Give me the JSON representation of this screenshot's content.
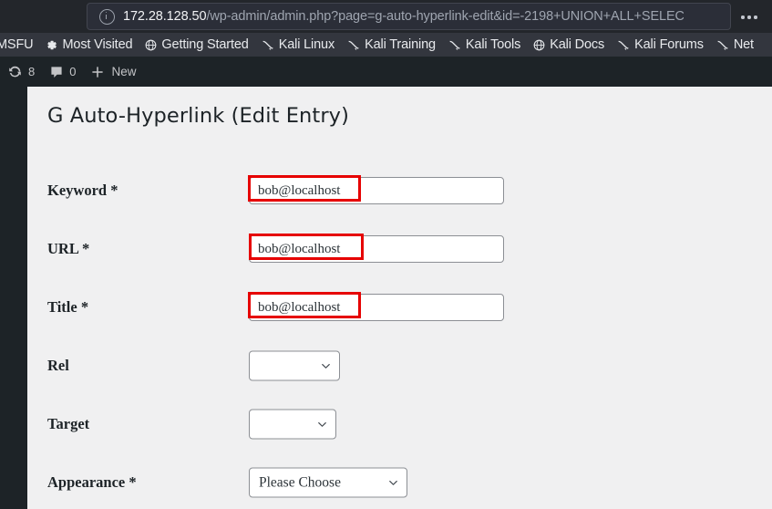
{
  "browser": {
    "url_host": "172.28.128.50",
    "url_path": "/wp-admin/admin.php?page=g-auto-hyperlink-edit&id=-2198+UNION+ALL+SELEC",
    "info_icon": "info-circle-icon",
    "menu_icon": "overflow-menu-icon",
    "bookmarks": [
      {
        "label": "MSFU",
        "icon": ""
      },
      {
        "label": "Most Visited",
        "icon": "gear-icon"
      },
      {
        "label": "Getting Started",
        "icon": "globe-icon"
      },
      {
        "label": "Kali Linux",
        "icon": "kali-dragon-icon"
      },
      {
        "label": "Kali Training",
        "icon": "kali-dragon-icon"
      },
      {
        "label": "Kali Tools",
        "icon": "kali-dragon-icon"
      },
      {
        "label": "Kali Docs",
        "icon": "globe-icon"
      },
      {
        "label": "Kali Forums",
        "icon": "kali-dragon-icon"
      },
      {
        "label": "Net",
        "icon": "kali-dragon-icon"
      }
    ]
  },
  "adminbar": {
    "updates_count": "8",
    "comments_count": "0",
    "new_label": "New",
    "updates_icon": "update-icon",
    "comments_icon": "comment-bubble-icon",
    "new_icon": "plus-icon"
  },
  "page": {
    "title": "G Auto-Hyperlink (Edit Entry)"
  },
  "form": {
    "rows": [
      {
        "label": "Keyword *",
        "type": "text",
        "value": "bob@localhost",
        "placeholder": "",
        "name": "keyword",
        "highlighted": true
      },
      {
        "label": "URL *",
        "type": "text",
        "value": "bob@localhost",
        "placeholder": "",
        "name": "url",
        "highlighted": true
      },
      {
        "label": "Title *",
        "type": "text",
        "value": "bob@localhost",
        "placeholder": "",
        "name": "title",
        "highlighted": true
      },
      {
        "label": "Rel",
        "type": "select",
        "value": "",
        "name": "rel",
        "highlighted": false
      },
      {
        "label": "Target",
        "type": "select",
        "value": "",
        "name": "target",
        "highlighted": false
      },
      {
        "label": "Appearance *",
        "type": "select",
        "value": "Please Choose",
        "name": "appearance",
        "highlighted": false
      }
    ]
  },
  "colors": {
    "annotation_red": "#e60000",
    "chrome_dark": "#23262b",
    "bookmarks_bar": "#33363e",
    "wp_dark": "#1d2327",
    "content_bg": "#f0f0f1"
  }
}
